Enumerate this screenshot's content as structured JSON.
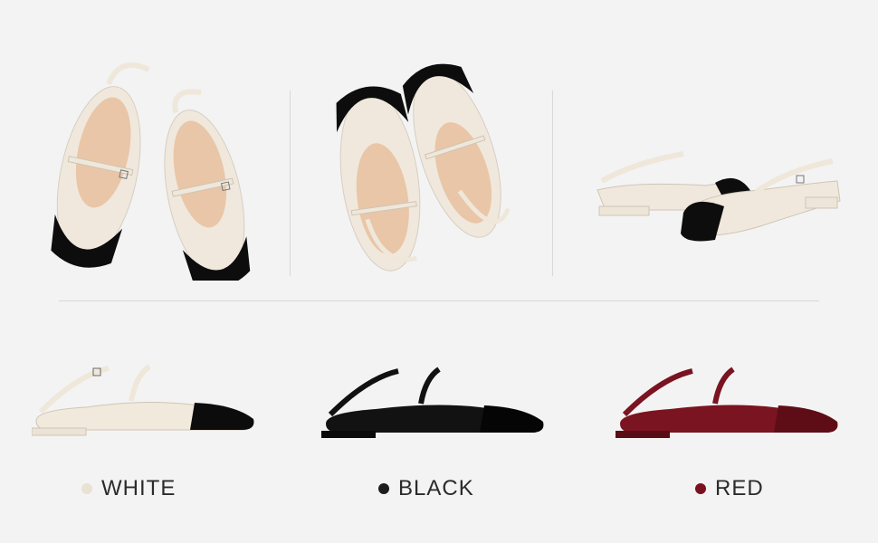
{
  "colors_section": {
    "options": [
      {
        "label": "WHITE",
        "dot_color": "#e9e1d2"
      },
      {
        "label": "BLACK",
        "dot_color": "#1c1c1c"
      },
      {
        "label": "RED",
        "dot_color": "#7b1020"
      }
    ]
  },
  "palette": {
    "background": "#f3f3f3",
    "cream": "#f1e9dc",
    "patent_black": "#0e0e0e",
    "wine_red": "#7a1420",
    "insole": "#efc7a8"
  }
}
